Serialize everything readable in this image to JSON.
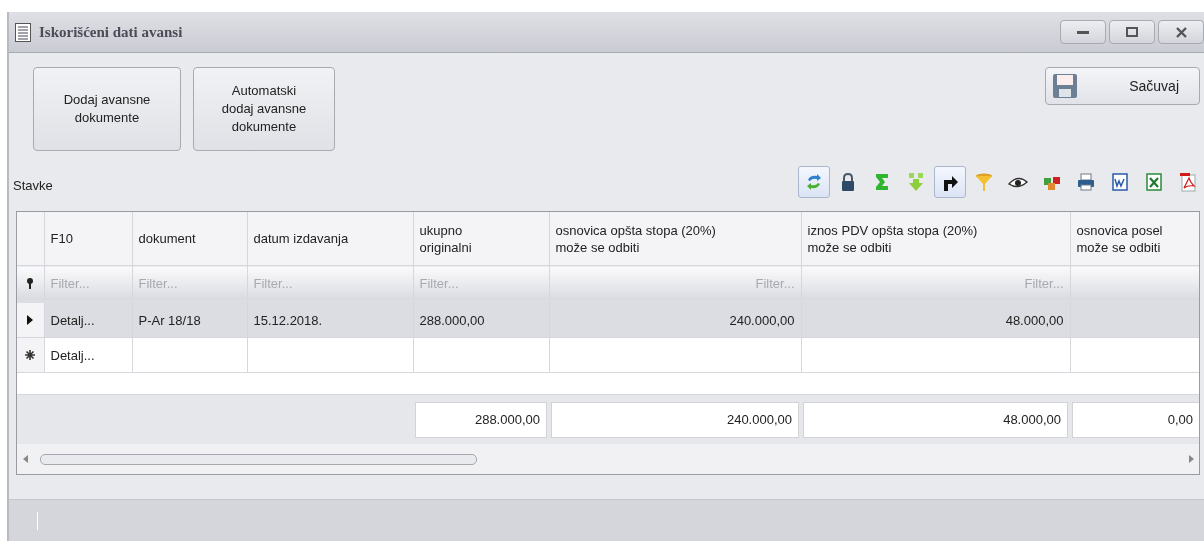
{
  "window": {
    "title": "Iskorišćeni dati avansi"
  },
  "actions": [
    {
      "label": "Dodaj avansne\ndokumente"
    },
    {
      "label": "Automatski\ndodaj avansne\ndokumente"
    }
  ],
  "save_button": {
    "label": "Sačuvaj"
  },
  "section_label": "Stavke",
  "toolbar": [
    {
      "kind": "refresh",
      "on": true
    },
    {
      "kind": "lock",
      "on": false
    },
    {
      "kind": "sum",
      "on": false
    },
    {
      "kind": "expand",
      "on": false
    },
    {
      "kind": "goto",
      "on": true
    },
    {
      "kind": "filter",
      "on": false
    },
    {
      "kind": "view",
      "on": false
    },
    {
      "kind": "cubes",
      "on": false
    },
    {
      "kind": "print",
      "on": false
    },
    {
      "kind": "word",
      "on": false
    },
    {
      "kind": "excel",
      "on": false
    },
    {
      "kind": "pdf",
      "on": false
    }
  ],
  "table": {
    "columns": [
      {
        "label": "F10",
        "kind": "text"
      },
      {
        "label": "dokument",
        "kind": "text"
      },
      {
        "label": "datum izdavanja",
        "kind": "text"
      },
      {
        "label": "ukupno\noriginalni",
        "kind": "text"
      },
      {
        "label": "osnovica opšta stopa (20%)\nmože se odbiti",
        "kind": "amount"
      },
      {
        "label": "iznos PDV opšta stopa (20%)\nmože se odbiti",
        "kind": "amount"
      },
      {
        "label": "osnovica posel\nmože se odbiti",
        "kind": "amount"
      }
    ],
    "filter_row": {
      "filters": [
        "Filter...",
        "Filter...",
        "Filter...",
        "Filter...",
        "Filter...",
        "Filter..."
      ]
    },
    "rows": [
      {
        "kind": "current",
        "selected": true,
        "cells": [
          "Detalj...",
          "P-Ar 18/18",
          "15.12.2018.",
          "288.000,00",
          "240.000,00",
          "48.000,00"
        ]
      },
      {
        "kind": "new",
        "selected": false,
        "cells": [
          "Detalj..."
        ]
      }
    ],
    "totals": [
      "288.000,00",
      "240.000,00",
      "48.000,00",
      "0,00"
    ]
  }
}
